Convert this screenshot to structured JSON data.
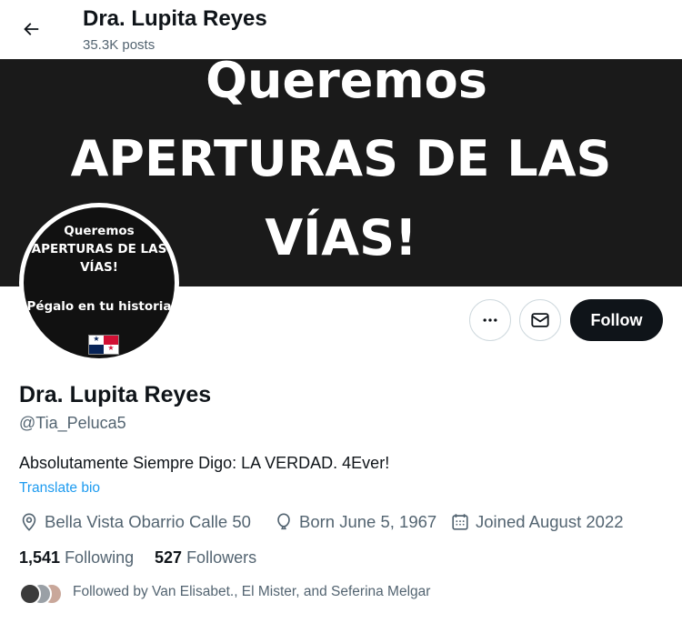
{
  "header": {
    "title": "Dra. Lupita Reyes",
    "posts_count": "35.3K posts"
  },
  "banner": {
    "line1": "Queremos",
    "line2": "APERTURAS DE LAS",
    "line3": "VÍAS!"
  },
  "avatar": {
    "line1": "Queremos",
    "line2": "APERTURAS DE LAS",
    "line3": "VÍAS!",
    "line4": "Pégalo en tu historia"
  },
  "actions": {
    "follow_label": "Follow"
  },
  "profile": {
    "name": "Dra. Lupita Reyes",
    "handle": "@Tia_Peluca5",
    "bio": "Absolutamente Siempre Digo: LA VERDAD. 4Ever!",
    "translate_label": "Translate bio",
    "location": "Bella Vista Obarrio Calle 50",
    "born": "Born June 5, 1967",
    "joined": "Joined August 2022",
    "following_count": "1,541",
    "following_label": "Following",
    "followers_count": "527",
    "followers_label": "Followers",
    "followed_by": "Followed by Van Elisabet., El Mister, and Seferina Melgar"
  },
  "colors": {
    "text_primary": "#0f1419",
    "text_secondary": "#536471",
    "link": "#1d9bf0",
    "follow_button_bg": "#0f1419",
    "banner_bg": "#1a1a1a"
  },
  "icons": [
    "back-arrow-icon",
    "more-icon",
    "mail-icon",
    "location-icon",
    "balloon-icon",
    "calendar-icon",
    "panama-flag-icon"
  ]
}
